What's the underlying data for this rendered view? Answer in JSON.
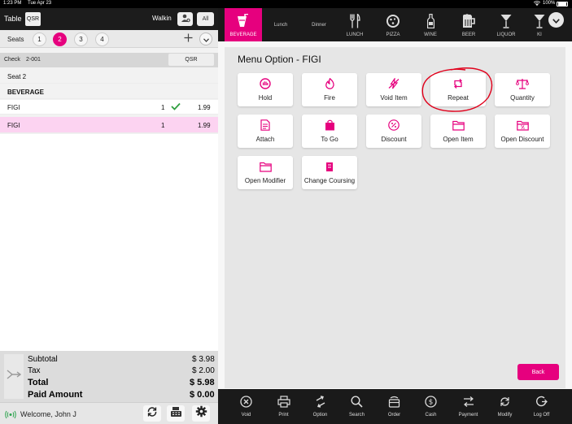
{
  "status": {
    "time": "1:23 PM",
    "date": "Tue Apr 23",
    "battery": "100%"
  },
  "header": {
    "table_label": "Table",
    "qsr_label": "QSR",
    "walkin_label": "Walkin",
    "all_label": "All"
  },
  "seats": {
    "label": "Seats",
    "items": [
      "1",
      "2",
      "3",
      "4"
    ],
    "active": "2"
  },
  "check": {
    "label": "Check",
    "number": "2-001",
    "type": "QSR"
  },
  "order": {
    "seat_label": "Seat 2",
    "category": "BEVERAGE",
    "items": [
      {
        "name": "FIGI",
        "qty": "1",
        "price": "1.99",
        "sent": true
      },
      {
        "name": "FIGI",
        "qty": "1",
        "price": "1.99",
        "sent": false
      }
    ]
  },
  "totals": {
    "subtotal_label": "Subtotal",
    "subtotal": "$ 3.98",
    "tax_label": "Tax",
    "tax": "$ 2.00",
    "total_label": "Total",
    "total": "$ 5.98",
    "paid_label": "Paid Amount",
    "paid": "$ 0.00"
  },
  "footer": {
    "welcome": "Welcome, John J"
  },
  "tabs": [
    {
      "label": "BEVERAGE",
      "icon": "beverage-icon",
      "active": true
    },
    {
      "label": "Lunch",
      "icon": "",
      "active": false
    },
    {
      "label": "Dinner",
      "icon": "",
      "active": false
    },
    {
      "label": "LUNCH",
      "icon": "fork-knife-icon",
      "active": false
    },
    {
      "label": "PIZZA",
      "icon": "pizza-icon",
      "active": false
    },
    {
      "label": "WINE",
      "icon": "wine-bottle-icon",
      "active": false
    },
    {
      "label": "BEER",
      "icon": "beer-icon",
      "active": false
    },
    {
      "label": "LIQUOR",
      "icon": "cocktail-icon",
      "active": false
    },
    {
      "label": "KI",
      "icon": "cocktail-icon",
      "active": false
    }
  ],
  "menu_option": {
    "title": "Menu Option - FIGI",
    "options": [
      {
        "label": "Hold",
        "icon": "hold-icon"
      },
      {
        "label": "Fire",
        "icon": "fire-icon"
      },
      {
        "label": "Void Item",
        "icon": "void-item-icon"
      },
      {
        "label": "Repeat",
        "icon": "repeat-icon"
      },
      {
        "label": "Quantity",
        "icon": "scale-icon"
      },
      {
        "label": "Attach",
        "icon": "document-icon"
      },
      {
        "label": "To Go",
        "icon": "bag-icon"
      },
      {
        "label": "Discount",
        "icon": "percent-icon"
      },
      {
        "label": "Open Item",
        "icon": "folder-icon"
      },
      {
        "label": "Open Discount",
        "icon": "folder-percent-icon"
      },
      {
        "label": "Open Modifier",
        "icon": "folder-icon"
      },
      {
        "label": "Change Coursing",
        "icon": "coursing-icon"
      }
    ],
    "back_label": "Back"
  },
  "bottom_bar": [
    {
      "label": "Void",
      "icon": "void-icon"
    },
    {
      "label": "Print",
      "icon": "print-icon"
    },
    {
      "label": "Option",
      "icon": "option-icon"
    },
    {
      "label": "Search",
      "icon": "search-icon"
    },
    {
      "label": "Order",
      "icon": "order-icon"
    },
    {
      "label": "Cash",
      "icon": "cash-icon"
    },
    {
      "label": "Payment",
      "icon": "payment-icon"
    },
    {
      "label": "Modify",
      "icon": "modify-icon"
    },
    {
      "label": "Log Off",
      "icon": "logoff-icon"
    }
  ],
  "colors": {
    "accent": "#e6007e",
    "dark_bar": "#1a1a1a",
    "annotation": "#e0001b"
  }
}
